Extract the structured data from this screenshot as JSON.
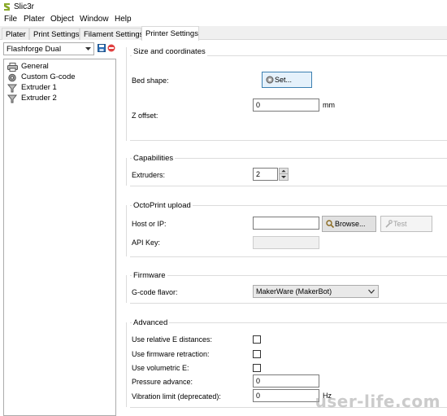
{
  "window": {
    "title": "Slic3r"
  },
  "menu": [
    "File",
    "Plater",
    "Object",
    "Window",
    "Help"
  ],
  "tabs": [
    "Plater",
    "Print Settings",
    "Filament Settings",
    "Printer Settings"
  ],
  "preset": {
    "selected": "Flashforge Dual"
  },
  "tree": [
    {
      "label": "General",
      "icon": "printer-icon"
    },
    {
      "label": "Custom G-code",
      "icon": "cog-icon"
    },
    {
      "label": "Extruder 1",
      "icon": "funnel-icon"
    },
    {
      "label": "Extruder 2",
      "icon": "funnel-icon"
    }
  ],
  "size_coordinates": {
    "title": "Size and coordinates",
    "bed_shape_label": "Bed shape:",
    "bed_shape_button": "Set...",
    "z_offset_label": "Z offset:",
    "z_offset_value": "0",
    "z_offset_unit": "mm"
  },
  "capabilities": {
    "title": "Capabilities",
    "extruders_label": "Extruders:",
    "extruders_value": "2"
  },
  "octoprint": {
    "title": "OctoPrint upload",
    "host_label": "Host or IP:",
    "host_value": "",
    "browse_button": "Browse...",
    "test_button": "Test",
    "api_key_label": "API Key:",
    "api_key_value": ""
  },
  "firmware": {
    "title": "Firmware",
    "flavor_label": "G-code flavor:",
    "flavor_value": "MakerWare (MakerBot)"
  },
  "advanced": {
    "title": "Advanced",
    "relative_e_label": "Use relative E distances:",
    "relative_e_checked": false,
    "fw_retraction_label": "Use firmware retraction:",
    "fw_retraction_checked": false,
    "volumetric_label": "Use volumetric E:",
    "volumetric_checked": false,
    "pressure_label": "Pressure advance:",
    "pressure_value": "0",
    "vibration_label": "Vibration limit (deprecated):",
    "vibration_value": "0",
    "vibration_unit": "Hz"
  },
  "watermark": "user-life.com",
  "colors": {
    "focus": "#3c7fb1",
    "delete": "#e04040",
    "save": "#2a6fb8"
  }
}
